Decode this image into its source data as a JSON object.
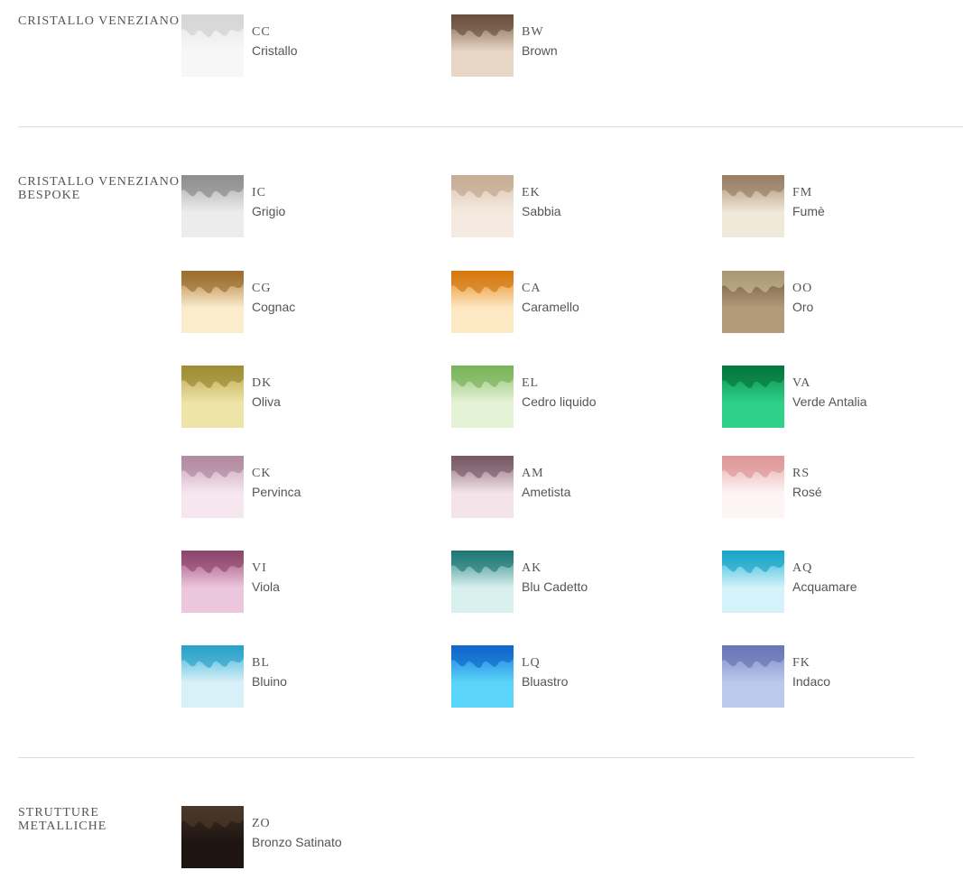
{
  "sections": [
    {
      "title": "CRISTALLO VENEZIANO",
      "items": [
        {
          "code": "CC",
          "name": "Cristallo",
          "top": "#e6e6e6",
          "bottom": "#f7f7f7",
          "accent": "#c9c9c9"
        },
        {
          "code": "BW",
          "name": "Brown",
          "top": "#7a5e48",
          "bottom": "#e8d7c6",
          "accent": "#5a4030"
        }
      ]
    },
    {
      "title": "CRISTALLO VENEZIANO BESPOKE",
      "items": [
        {
          "code": "IC",
          "name": "Grigio",
          "top": "#a8a8a8",
          "bottom": "#ececec",
          "accent": "#7a7a7a"
        },
        {
          "code": "EK",
          "name": "Sabbia",
          "top": "#d9c3ae",
          "bottom": "#f4eadf",
          "accent": "#b89a80"
        },
        {
          "code": "FM",
          "name": "Fumè",
          "top": "#a88e72",
          "bottom": "#f0e8d8",
          "accent": "#8a7058"
        },
        {
          "code": "CG",
          "name": "Cognac",
          "top": "#b07e3a",
          "bottom": "#fbeccc",
          "accent": "#8a5e20"
        },
        {
          "code": "CA",
          "name": "Caramello",
          "top": "#e6881a",
          "bottom": "#fde8c4",
          "accent": "#c86a00"
        },
        {
          "code": "OO",
          "name": "Oro",
          "top": "#6e5a40",
          "bottom": "#b39a78",
          "accent": "#d8c8a0"
        },
        {
          "code": "DK",
          "name": "Oliva",
          "top": "#b8a448",
          "bottom": "#efe4a8",
          "accent": "#8a7a20"
        },
        {
          "code": "EL",
          "name": "Cedro liquido",
          "top": "#8ec46e",
          "bottom": "#e4f2d6",
          "accent": "#6aa848"
        },
        {
          "code": "VA",
          "name": "Verde Antalia",
          "top": "#0a8a4a",
          "bottom": "#2ed08a",
          "accent": "#006a34"
        },
        {
          "code": "CK",
          "name": "Pervinca",
          "top": "#c9a0b8",
          "bottom": "#f6e6ee",
          "accent": "#a07890"
        },
        {
          "code": "AM",
          "name": "Ametista",
          "top": "#8a6a78",
          "bottom": "#f4e4ea",
          "accent": "#6a4a58"
        },
        {
          "code": "RS",
          "name": "Rosé",
          "top": "#e8a8a8",
          "bottom": "#fdf4f4",
          "accent": "#d88888"
        },
        {
          "code": "VI",
          "name": "Viola",
          "top": "#a0507a",
          "bottom": "#ecc6dc",
          "accent": "#803a60"
        },
        {
          "code": "AK",
          "name": "Blu Cadetto",
          "top": "#2a8a88",
          "bottom": "#d8f0ee",
          "accent": "#106a68"
        },
        {
          "code": "AQ",
          "name": "Acquamare",
          "top": "#2ab8d8",
          "bottom": "#d4f2fa",
          "accent": "#0a98c0"
        },
        {
          "code": "BL",
          "name": "Bluino",
          "top": "#3ab4d8",
          "bottom": "#d8f0f8",
          "accent": "#1a94c0"
        },
        {
          "code": "LQ",
          "name": "Bluastro",
          "top": "#1a78e0",
          "bottom": "#5ad4f8",
          "accent": "#0a58c0"
        },
        {
          "code": "FK",
          "name": "Indaco",
          "top": "#7a8ac8",
          "bottom": "#bcc8ec",
          "accent": "#5a68a8"
        }
      ]
    },
    {
      "title": "STRUTTURE METALLICHE",
      "items": [
        {
          "code": "ZO",
          "name": "Bronzo Satinato",
          "top": "#3e2e24",
          "bottom": "#1e1410",
          "accent": "#54402e"
        }
      ]
    }
  ]
}
